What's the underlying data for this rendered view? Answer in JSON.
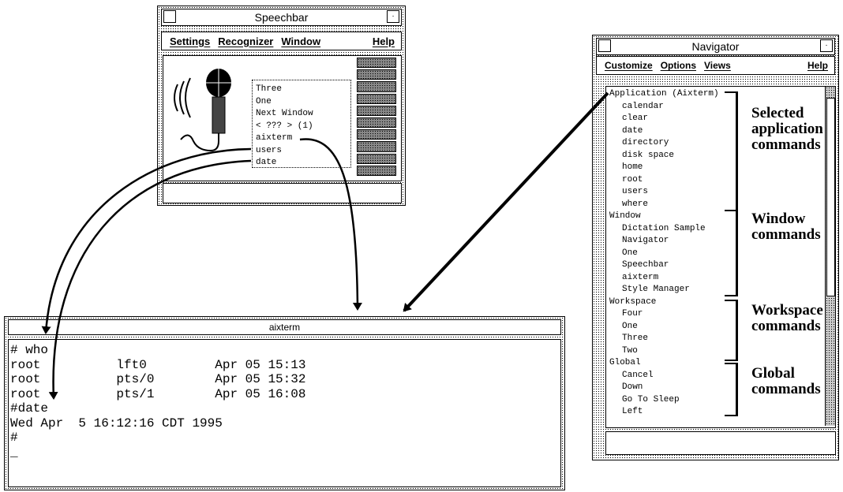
{
  "speechbar": {
    "title": "Speechbar",
    "menu": [
      "Settings",
      "Recognizer",
      "Window"
    ],
    "help": "Help",
    "history": [
      "Three",
      "One",
      "Next Window",
      "< ??? > (1)",
      "aixterm",
      "users",
      "date"
    ],
    "microphone_icon": "microphone-with-sound-waves",
    "meter_segments": 10
  },
  "navigator": {
    "title": "Navigator",
    "menu": [
      "Customize",
      "Options",
      "Views"
    ],
    "help": "Help",
    "groups": [
      {
        "header": "Application (Aixterm)",
        "items": [
          "calendar",
          "clear",
          "date",
          "directory",
          "disk space",
          "home",
          "root",
          "users",
          "where"
        ]
      },
      {
        "header": "Window",
        "items": [
          "Dictation Sample",
          "Navigator",
          "One",
          "Speechbar",
          "aixterm",
          "Style Manager"
        ]
      },
      {
        "header": "Workspace",
        "items": [
          "Four",
          "One",
          "Three",
          "Two"
        ]
      },
      {
        "header": "Global",
        "items": [
          "Cancel",
          "Down",
          "Go To Sleep",
          "Left"
        ]
      }
    ]
  },
  "annotations": {
    "selected": "Selected application commands",
    "window": "Window commands",
    "workspace": "Workspace commands",
    "global": "Global commands"
  },
  "terminal": {
    "title": "aixterm",
    "lines": [
      "# who",
      "root          lft0         Apr 05 15:13",
      "root          pts/0        Apr 05 15:32",
      "root          pts/1        Apr 05 16:08",
      "#date",
      "Wed Apr  5 16:12:16 CDT 1995",
      "#",
      "",
      "_"
    ]
  }
}
